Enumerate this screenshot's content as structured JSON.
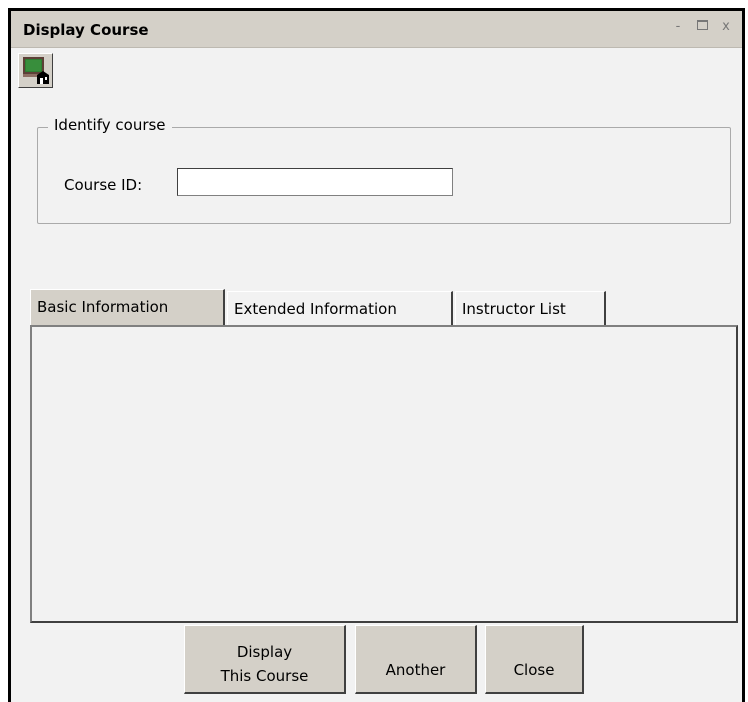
{
  "window": {
    "title": "Display Course"
  },
  "controls": {
    "minimize": "-",
    "close": "x"
  },
  "toolbar": {
    "icon": "course-display-icon"
  },
  "identify": {
    "legend": "Identify course",
    "course_id_label": "Course ID:",
    "course_id_value": ""
  },
  "tabs": [
    {
      "label": "Basic Information",
      "active": true
    },
    {
      "label": "Extended Information",
      "active": false
    },
    {
      "label": "Instructor List",
      "active": false
    }
  ],
  "buttons": {
    "display_line1": "Display",
    "display_line2": "This Course",
    "another": "Another",
    "close": "Close"
  }
}
